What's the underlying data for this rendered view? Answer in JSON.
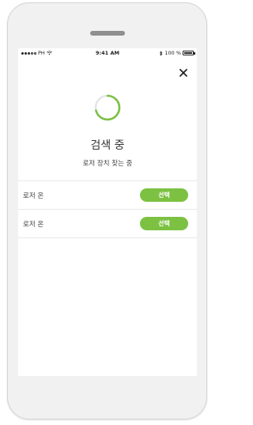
{
  "status_bar": {
    "carrier": "PH",
    "time": "9:41 AM",
    "battery": "100 %"
  },
  "screen": {
    "title": "검색 중",
    "subtitle": "로저 장치 찾는 중",
    "close_icon": "close-icon",
    "spinner_icon": "loading-spinner-icon"
  },
  "devices": [
    {
      "name": "로저 온",
      "button_label": "선택"
    },
    {
      "name": "로저 온",
      "button_label": "선택"
    }
  ],
  "colors": {
    "accent": "#7cc142",
    "spinner": "#7cc142"
  }
}
